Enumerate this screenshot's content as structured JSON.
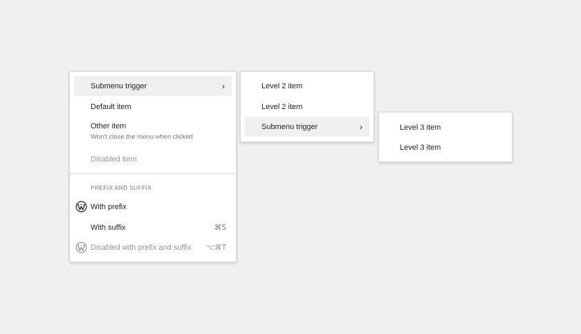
{
  "level1": {
    "submenu_trigger": "Submenu trigger",
    "submenu_chevron": "›",
    "default_item": "Default item",
    "other_item": "Other item",
    "other_item_help": "Won't close the menu when clicked",
    "disabled_item": "Disabled item",
    "group_label": "PREFIX AND SUFFIX",
    "with_prefix": "With prefix",
    "with_suffix": "With suffix",
    "with_suffix_shortcut": "⌘S",
    "disabled_prefix_suffix": "Disabled with prefix and suffix",
    "disabled_prefix_suffix_shortcut": "⌥⌘T"
  },
  "level2": {
    "item1": "Level 2 item",
    "item2": "Level 2 item",
    "submenu_trigger": "Submenu trigger",
    "submenu_chevron": "›"
  },
  "level3": {
    "item1": "Level 3 item",
    "item2": "Level 3 item"
  },
  "icons": {
    "prefix": "wordpress-logo-icon",
    "chevron": "chevron-right-icon"
  },
  "colors": {
    "background": "#f0f0f0",
    "menu_bg": "#ffffff",
    "active_bg": "#f0f0f0",
    "text": "#1e1e1e",
    "muted": "#757575",
    "disabled": "#949494"
  }
}
